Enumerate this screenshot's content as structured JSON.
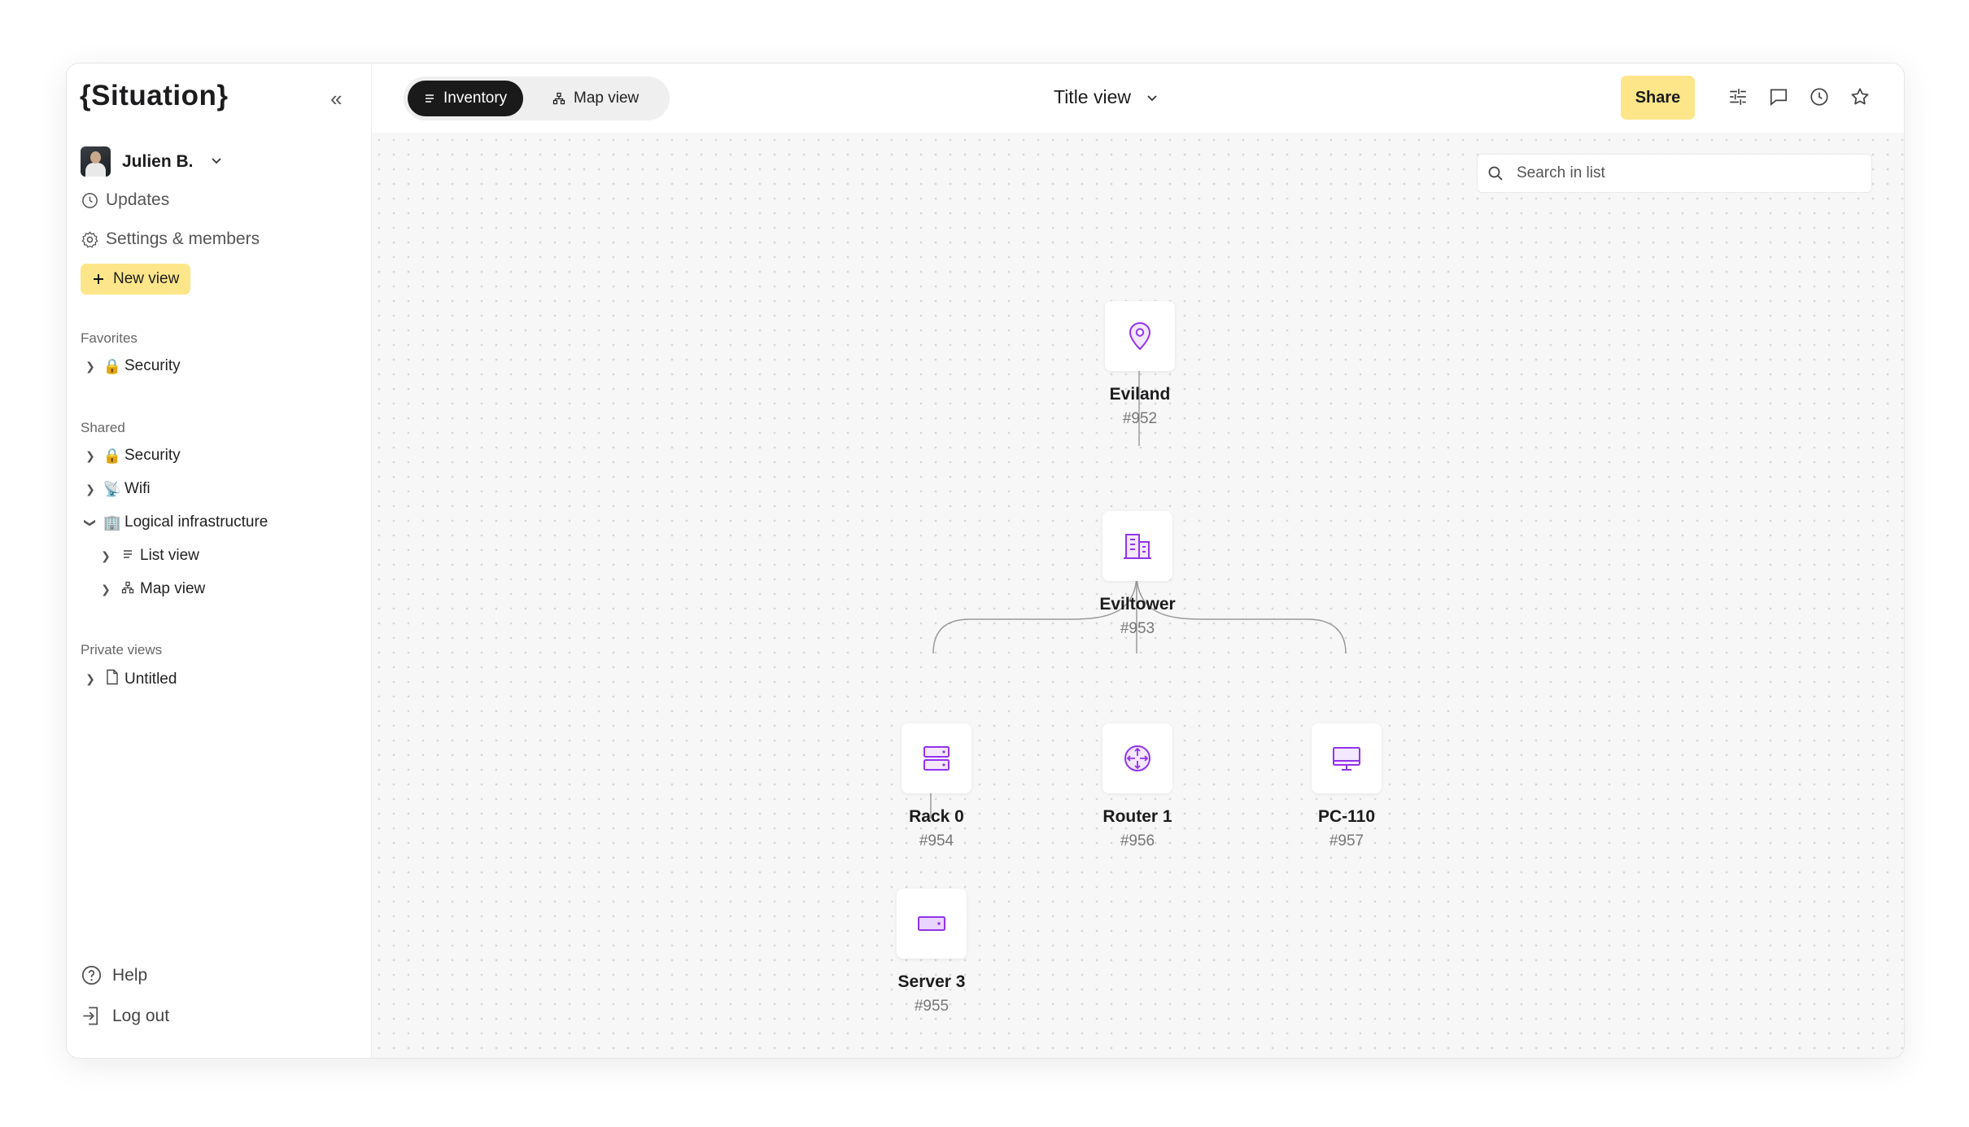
{
  "sidebar": {
    "logo": "{Situation}",
    "user": {
      "name": "Julien B."
    },
    "nav": {
      "updates": "Updates",
      "settings": "Settings & members"
    },
    "new_view": "New view",
    "favorites": {
      "title": "Favorites",
      "items": [
        {
          "emoji": "🔒",
          "label": "Security"
        }
      ]
    },
    "shared": {
      "title": "Shared",
      "items": [
        {
          "emoji": "🔒",
          "label": "Security"
        },
        {
          "emoji": "📡",
          "label": "Wifi"
        },
        {
          "emoji": "🏢",
          "label": "Logical infrastructure"
        }
      ],
      "children": [
        {
          "label": "List view"
        },
        {
          "label": "Map view"
        }
      ]
    },
    "private": {
      "title": "Private views",
      "items": [
        {
          "label": "Untitled"
        }
      ]
    },
    "help": "Help",
    "logout": "Log out"
  },
  "topbar": {
    "tabs": [
      {
        "label": "Inventory",
        "active": true
      },
      {
        "label": "Map view",
        "active": false
      }
    ],
    "title_view": "Title view",
    "share": "Share"
  },
  "canvas": {
    "search_placeholder": "Search in list",
    "nodes": [
      {
        "name": "Eviland",
        "id": "#952",
        "icon": "map-pin-icon"
      },
      {
        "name": "Eviltower",
        "id": "#953",
        "icon": "building-icon"
      },
      {
        "name": "Rack 0",
        "id": "#954",
        "icon": "rack-icon"
      },
      {
        "name": "Router 1",
        "id": "#956",
        "icon": "router-icon"
      },
      {
        "name": "PC-110",
        "id": "#957",
        "icon": "monitor-icon"
      },
      {
        "name": "Server 3",
        "id": "#955",
        "icon": "server-icon"
      }
    ]
  },
  "colors": {
    "accent_yellow": "#fde68a",
    "icon_purple": "#9333ea",
    "active_tab": "#1a1a1a"
  }
}
